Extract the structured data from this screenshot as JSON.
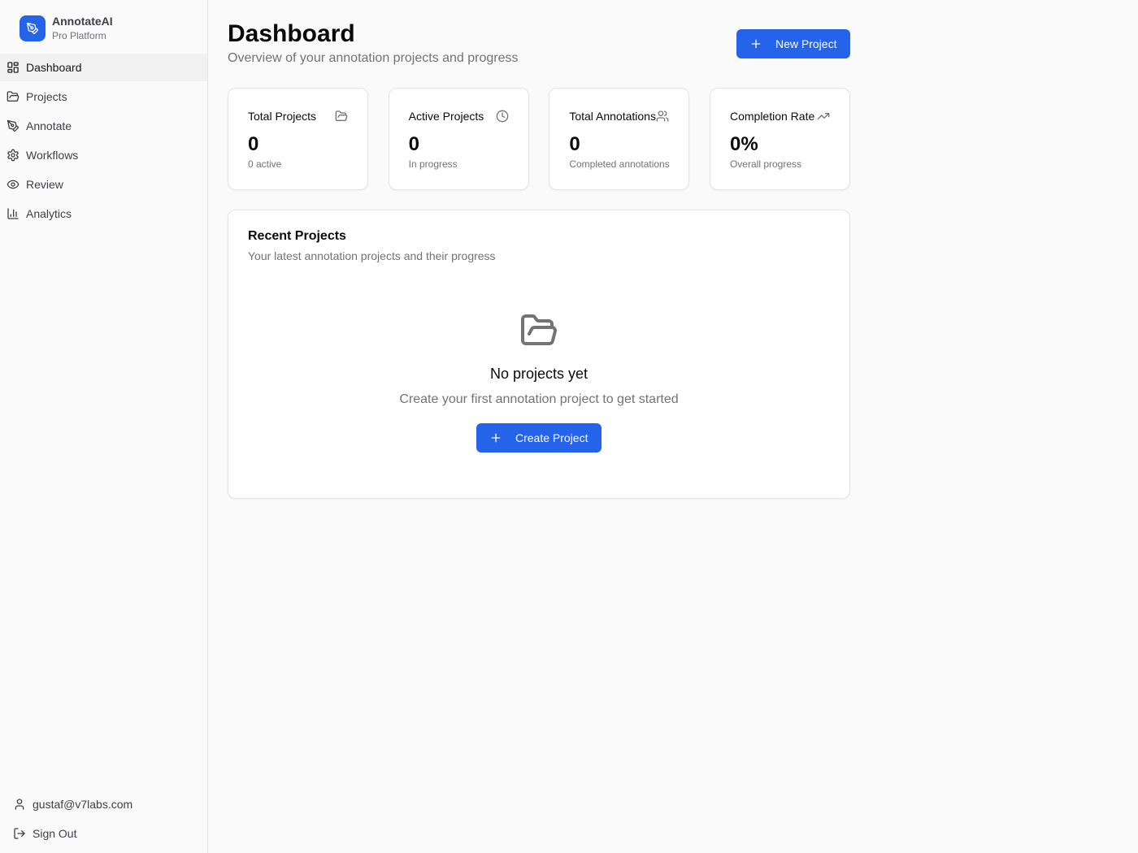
{
  "brand": {
    "name": "AnnotateAI",
    "subtitle": "Pro Platform"
  },
  "nav": {
    "items": [
      {
        "label": "Dashboard",
        "icon": "grid-icon",
        "active": true
      },
      {
        "label": "Projects",
        "icon": "folder-icon"
      },
      {
        "label": "Annotate",
        "icon": "pen-tool-icon"
      },
      {
        "label": "Workflows",
        "icon": "gear-icon"
      },
      {
        "label": "Review",
        "icon": "eye-icon"
      },
      {
        "label": "Analytics",
        "icon": "bar-chart-icon"
      }
    ]
  },
  "footer": {
    "user_email": "gustaf@v7labs.com",
    "sign_out_label": "Sign Out"
  },
  "header": {
    "title": "Dashboard",
    "subtitle": "Overview of your annotation projects and progress",
    "new_project_label": "New Project"
  },
  "stats": [
    {
      "label": "Total Projects",
      "value": "0",
      "note": "0 active",
      "icon": "folder-icon"
    },
    {
      "label": "Active Projects",
      "value": "0",
      "note": "In progress",
      "icon": "clock-icon"
    },
    {
      "label": "Total Annotations",
      "value": "0",
      "note": "Completed annotations",
      "icon": "users-icon"
    },
    {
      "label": "Completion Rate",
      "value": "0%",
      "note": "Overall progress",
      "icon": "trending-up-icon"
    }
  ],
  "recent": {
    "title": "Recent Projects",
    "subtitle": "Your latest annotation projects and their progress",
    "empty_title": "No projects yet",
    "empty_subtitle": "Create your first annotation project to get started",
    "create_label": "Create Project"
  },
  "colors": {
    "accent": "#2563eb",
    "text_muted": "#737373",
    "border": "#e5e5e5"
  }
}
